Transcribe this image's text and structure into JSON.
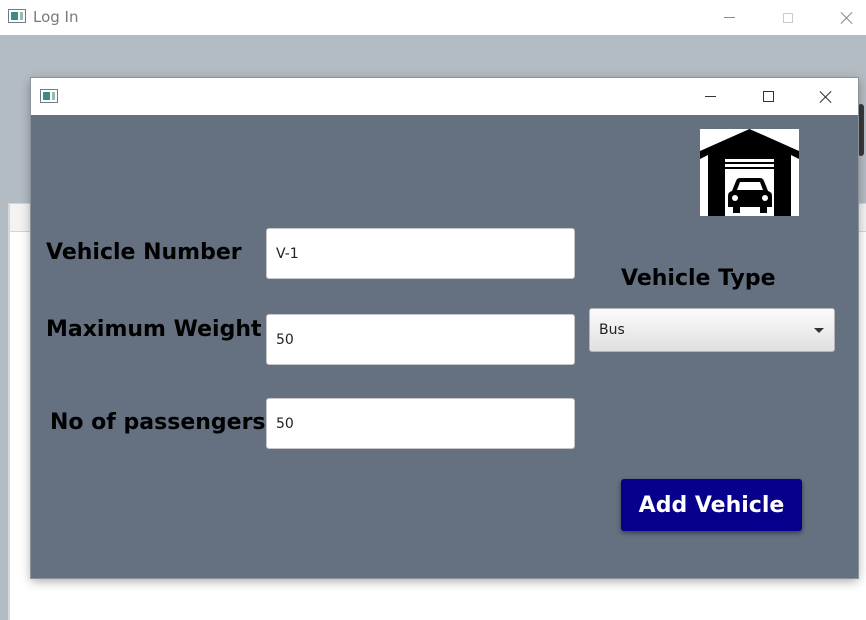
{
  "outer_window": {
    "title": "Log In"
  },
  "dialog": {
    "fields": {
      "vehicle_number": {
        "label": "Vehicle Number",
        "value": "V-1"
      },
      "maximum_weight": {
        "label": "Maximum Weight",
        "value": "50"
      },
      "passengers": {
        "label": "No of passengers",
        "value": "50"
      }
    },
    "vehicle_type": {
      "label": "Vehicle Type",
      "selected": "Bus"
    },
    "add_button_label": "Add Vehicle",
    "logo_icon": "garage-car-icon"
  },
  "colors": {
    "dialog_background": "#657080",
    "button_background": "#07008c",
    "desktop_background": "#b4bcc3"
  }
}
